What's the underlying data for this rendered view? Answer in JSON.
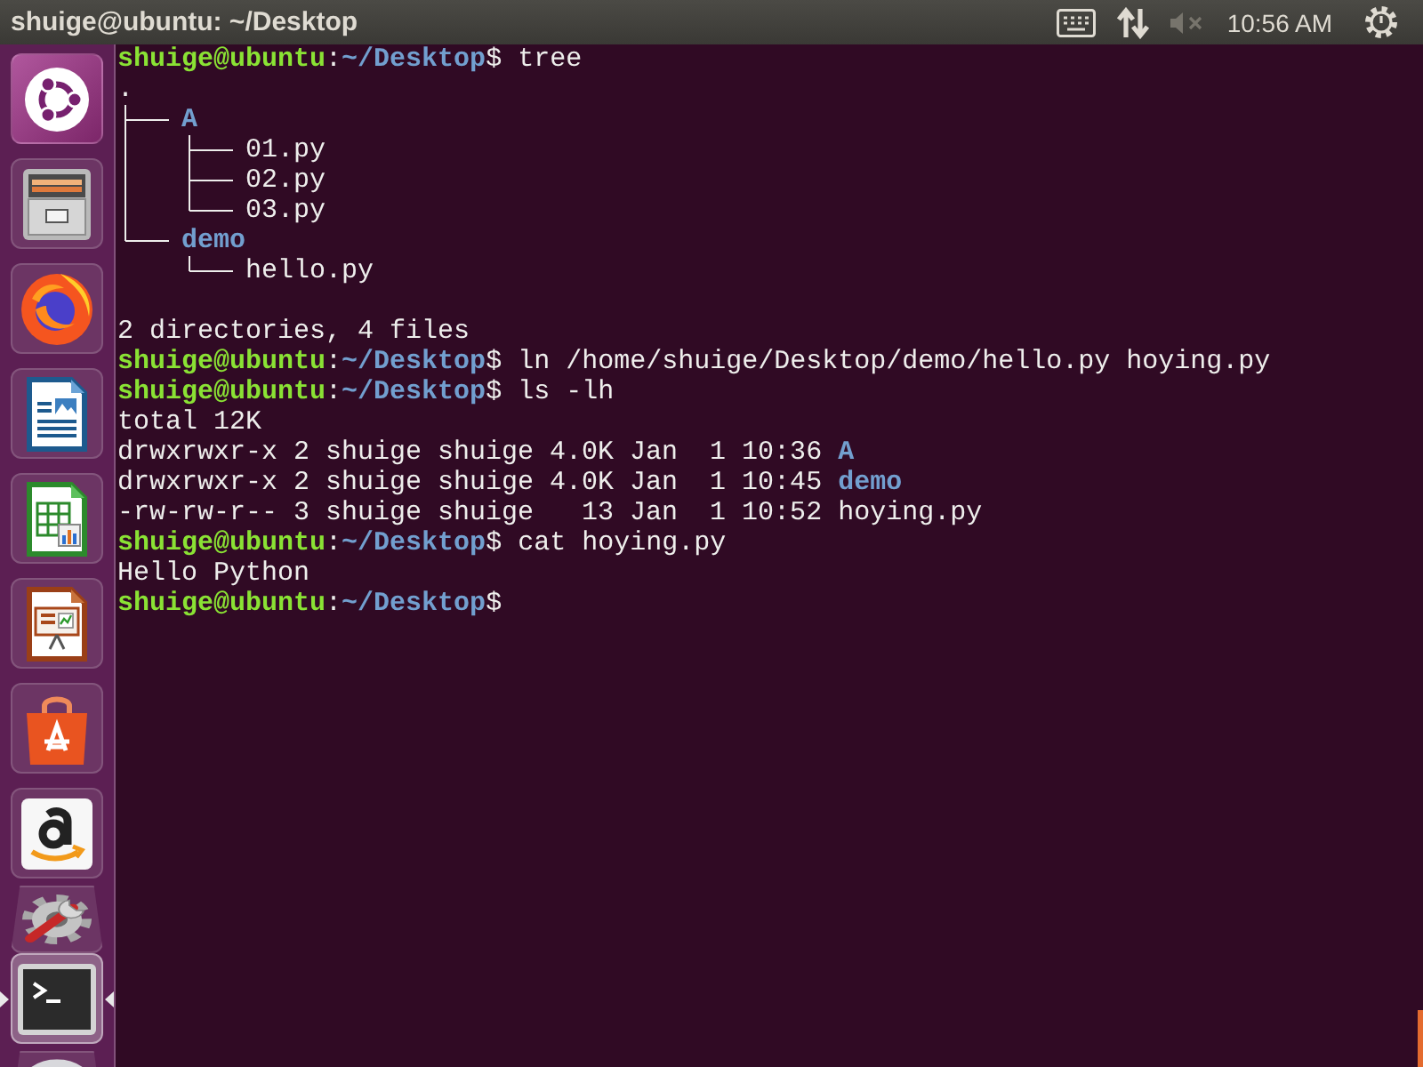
{
  "top_bar": {
    "title": "shuige@ubuntu: ~/Desktop",
    "sound_muted": true,
    "clock": "10:56 AM"
  },
  "launcher": {
    "items": [
      {
        "kind": "dash",
        "selected": false,
        "folded": false
      },
      {
        "kind": "files",
        "selected": false,
        "folded": false
      },
      {
        "kind": "browser",
        "selected": false,
        "folded": false
      },
      {
        "kind": "writer",
        "selected": false,
        "folded": false
      },
      {
        "kind": "spreadsheet",
        "selected": false,
        "folded": false
      },
      {
        "kind": "presentation",
        "selected": false,
        "folded": false
      },
      {
        "kind": "software",
        "selected": false,
        "folded": false
      },
      {
        "kind": "store",
        "selected": false,
        "folded": false
      },
      {
        "kind": "settings",
        "selected": false,
        "folded": true
      },
      {
        "kind": "terminal",
        "selected": true,
        "folded": false
      },
      {
        "kind": "disc",
        "selected": false,
        "folded": true
      }
    ]
  },
  "terminal": {
    "lines": [
      {
        "kind": "prompt",
        "user": "shuige@ubuntu",
        "sep": ":",
        "path": "~/Desktop",
        "mark": "$",
        "command": "tree"
      },
      {
        "kind": "tree",
        "root": ".",
        "children": [
          {
            "name": "A",
            "directory": true,
            "children": [
              {
                "name": "01.py",
                "directory": false
              },
              {
                "name": "02.py",
                "directory": false
              },
              {
                "name": "03.py",
                "directory": false
              }
            ]
          },
          {
            "name": "demo",
            "directory": true,
            "children": [
              {
                "name": "hello.py",
                "directory": false
              }
            ]
          }
        ],
        "summary": "2 directories, 4 files"
      },
      {
        "kind": "prompt",
        "user": "shuige@ubuntu",
        "sep": ":",
        "path": "~/Desktop",
        "mark": "$",
        "command": "ln /home/shuige/Desktop/demo/hello.py hoying.py"
      },
      {
        "kind": "prompt",
        "user": "shuige@ubuntu",
        "sep": ":",
        "path": "~/Desktop",
        "mark": "$",
        "command": "ls -lh"
      },
      {
        "kind": "text",
        "text": "total 12K"
      },
      {
        "kind": "listing",
        "details": "drwxrwxr-x 2 shuige shuige 4.0K Jan  1 10:36",
        "name": "A",
        "directory": true
      },
      {
        "kind": "listing",
        "details": "drwxrwxr-x 2 shuige shuige 4.0K Jan  1 10:45",
        "name": "demo",
        "directory": true
      },
      {
        "kind": "listing",
        "details": "-rw-rw-r-- 3 shuige shuige   13 Jan  1 10:52",
        "name": "hoying.py",
        "directory": false
      },
      {
        "kind": "prompt",
        "user": "shuige@ubuntu",
        "sep": ":",
        "path": "~/Desktop",
        "mark": "$",
        "command": "cat hoying.py"
      },
      {
        "kind": "text",
        "text": "Hello Python"
      },
      {
        "kind": "prompt",
        "user": "shuige@ubuntu",
        "sep": ":",
        "path": "~/Desktop",
        "mark": "$"
      }
    ]
  }
}
